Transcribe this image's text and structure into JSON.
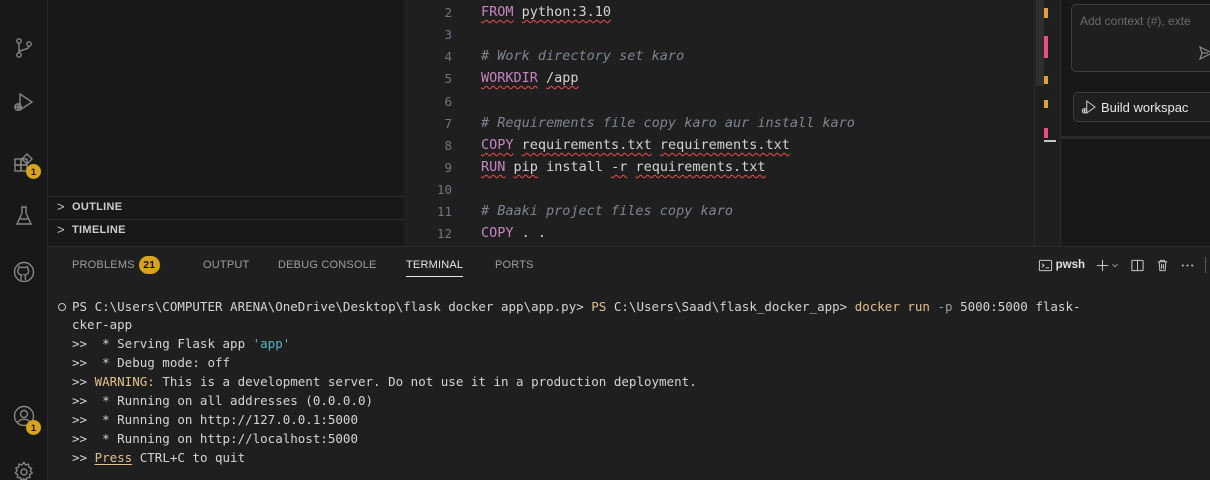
{
  "sidebar": {
    "sections": [
      {
        "label": "OUTLINE"
      },
      {
        "label": "TIMELINE"
      }
    ]
  },
  "activity_bar": {
    "extensions_badge": "1",
    "accounts_badge": "1"
  },
  "editor": {
    "lines": [
      {
        "num": "2"
      },
      {
        "num": "3"
      },
      {
        "num": "4"
      },
      {
        "num": "5"
      },
      {
        "num": "6"
      },
      {
        "num": "7"
      },
      {
        "num": "8"
      },
      {
        "num": "9"
      },
      {
        "num": "10"
      },
      {
        "num": "11"
      },
      {
        "num": "12"
      }
    ],
    "code": {
      "l2_kw": "FROM",
      "l2_rest": "python:3.10",
      "l4": "# Work directory set karo",
      "l5_kw": "WORKDIR",
      "l5_rest": "/app",
      "l7": "# Requirements file copy karo aur install karo",
      "l8_kw": "COPY",
      "l8_a": "requirements.txt",
      "l8_b": "requirements.txt",
      "l9_kw": "RUN",
      "l9_a": "pip",
      "l9_b": "install",
      "l9_c": "-r",
      "l9_d": "requirements.txt",
      "l11": "# Baaki project files copy karo",
      "l12_kw": "COPY",
      "l12_rest": ". ."
    }
  },
  "chat": {
    "input_placeholder": "Add context (#), exte",
    "build_button": "Build workspac"
  },
  "panel": {
    "tabs": {
      "problems": "PROBLEMS",
      "problems_count": "21",
      "output": "OUTPUT",
      "debug_console": "DEBUG CONSOLE",
      "terminal": "TERMINAL",
      "ports": "PORTS"
    },
    "shell_name": "pwsh"
  },
  "terminal": {
    "prompt_path_1": "PS C:\\Users\\COMPUTER ARENA\\OneDrive\\Desktop\\flask docker app\\app.py>",
    "prompt_ps": "PS",
    "prompt_path_2": "C:\\Users\\Saad\\flask_docker_app>",
    "cmd_docker": "docker run",
    "cmd_flag": "-p",
    "cmd_port": "5000:5000",
    "cmd_image_start": "flask-",
    "cmd_image_end": "cker-app",
    "serving_prefix": ">>  * Serving Flask app ",
    "serving_app": "'app'",
    "debug": ">>  * Debug mode: off",
    "warn_prefix": ">> ",
    "warn_label": "WARNING:",
    "warn_text": " This is a development server. Do not use it in a production deployment.",
    "run_all": ">>  * Running on all addresses (0.0.0.0)",
    "run_local": ">>  * Running on http://127.0.0.1:5000",
    "run_host": ">>  * Running on http://localhost:5000",
    "quit_prefix": ">> ",
    "quit_press": "Press",
    "quit_rest": " CTRL+C to quit"
  }
}
